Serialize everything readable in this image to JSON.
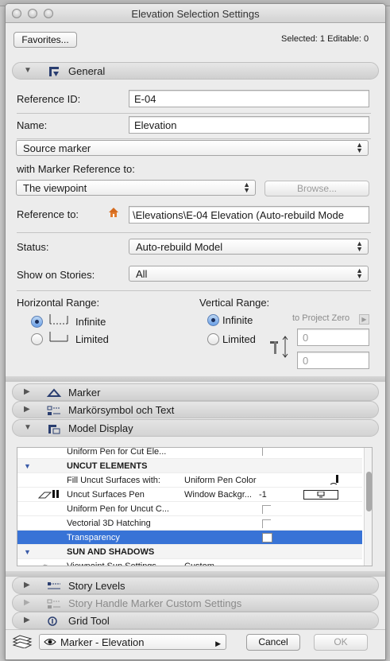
{
  "window": {
    "title": "Elevation Selection Settings"
  },
  "top": {
    "favorites_label": "Favorites...",
    "selection_status": "Selected: 1 Editable: 0"
  },
  "general": {
    "header": "General",
    "reference_id_label": "Reference ID:",
    "reference_id_value": "E-04",
    "name_label": "Name:",
    "name_value": "Elevation",
    "marker_type": "Source marker",
    "marker_ref_label": "with Marker Reference to:",
    "marker_ref_value": "The viewpoint",
    "browse_label": "Browse...",
    "reference_to_label": "Reference to:",
    "reference_to_value": "\\Elevations\\E-04 Elevation (Auto-rebuild Mode",
    "status_label": "Status:",
    "status_value": "Auto-rebuild Model",
    "stories_label": "Show on Stories:",
    "stories_value": "All",
    "horizontal_range_label": "Horizontal Range:",
    "h_infinite": "Infinite",
    "h_limited": "Limited",
    "vertical_range_label": "Vertical Range:",
    "v_infinite": "Infinite",
    "v_limited": "Limited",
    "to_project_zero": "to Project Zero",
    "v_top_value": "0",
    "v_bottom_value": "0"
  },
  "panels": {
    "marker": "Marker",
    "marker_symbol": "Markörsymbol och Text",
    "model_display": "Model Display",
    "story_levels": "Story Levels",
    "story_handle": "Story Handle Marker Custom Settings",
    "grid_tool": "Grid Tool"
  },
  "model_table": {
    "rows": [
      {
        "name": "Uniform Pen for Cut Ele...",
        "value": ""
      },
      {
        "group": "UNCUT ELEMENTS"
      },
      {
        "name": "Fill Uncut Surfaces with:",
        "value": "Uniform Pen Color"
      },
      {
        "name": "Uncut Surfaces Pen",
        "value": "Window Backgr...",
        "extra": "-1"
      },
      {
        "name": "Uniform Pen for Uncut C...",
        "value": ""
      },
      {
        "name": "Vectorial 3D Hatching",
        "value": ""
      },
      {
        "name": "Transparency",
        "value": ""
      },
      {
        "group": "SUN AND SHADOWS"
      },
      {
        "name": "Viewpoint Sun Settings",
        "value": "Custom"
      }
    ]
  },
  "bottom": {
    "layer_value": "Marker - Elevation",
    "cancel_label": "Cancel",
    "ok_label": "OK"
  }
}
